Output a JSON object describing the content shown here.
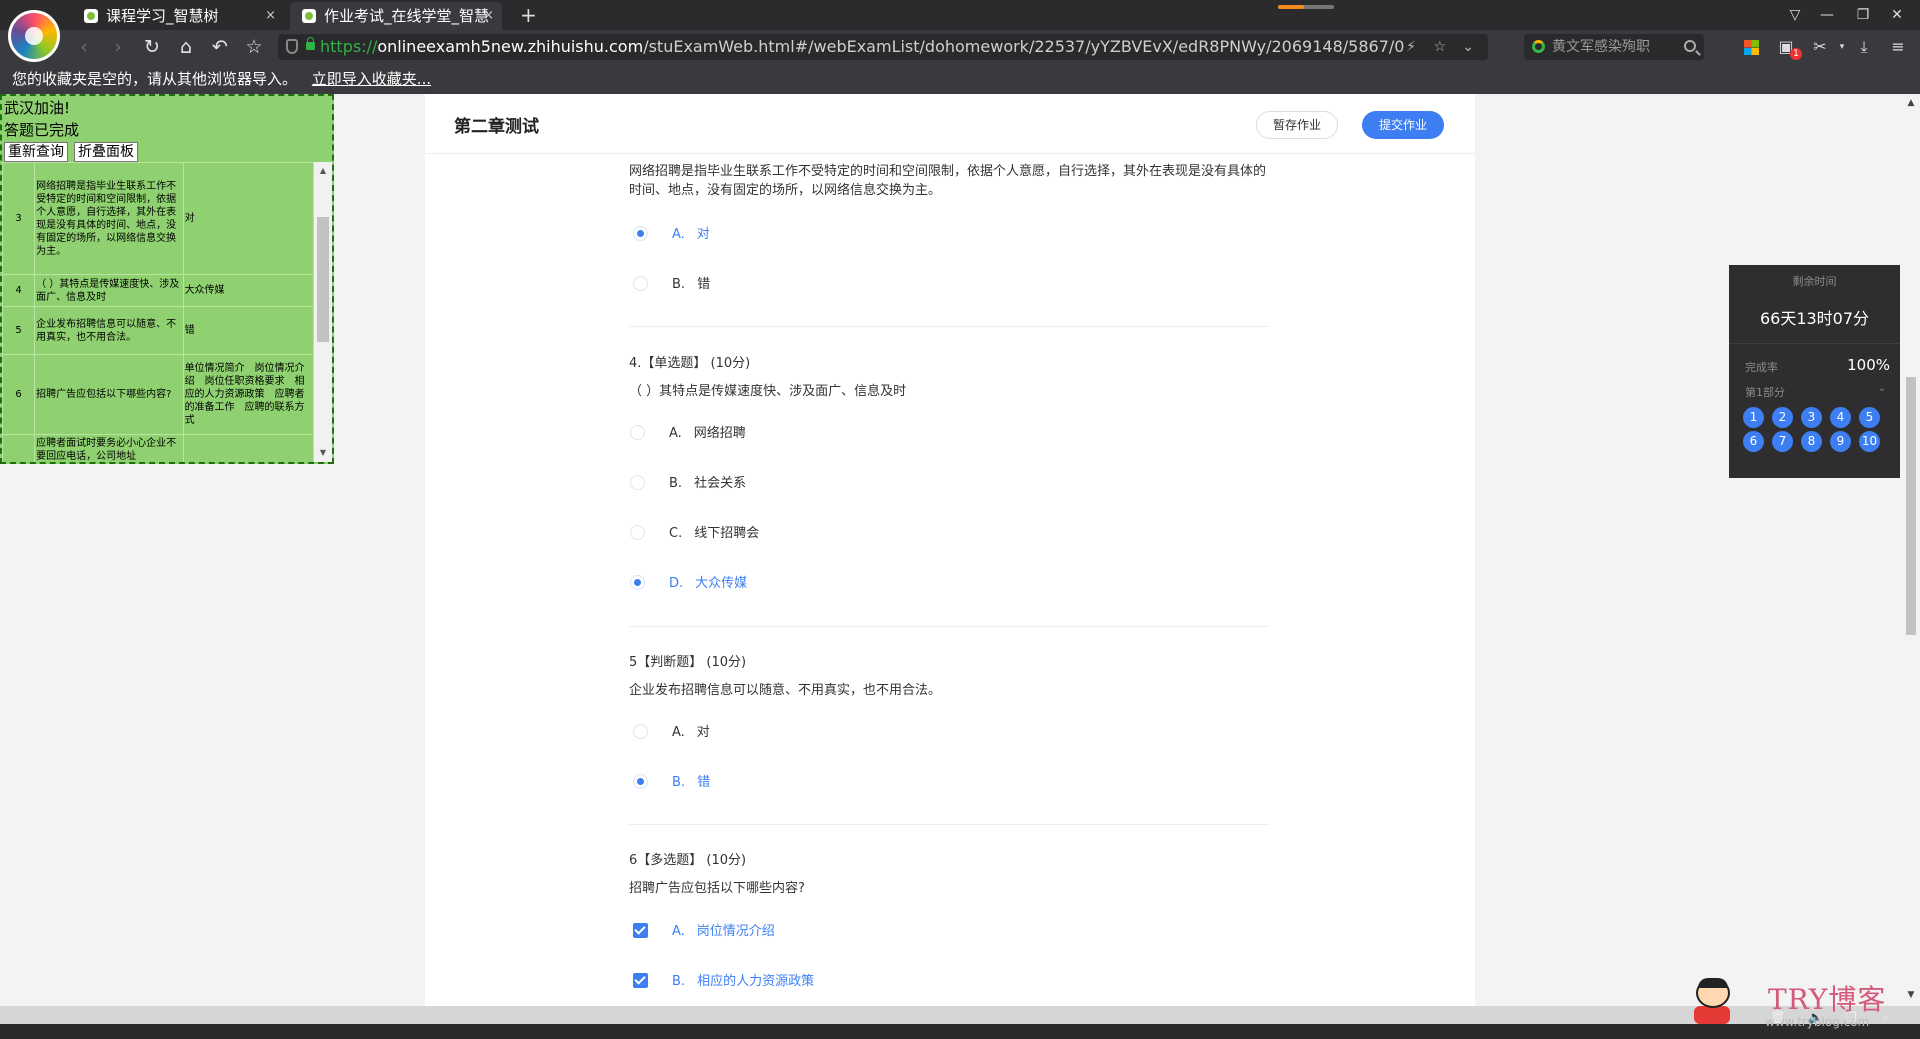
{
  "browser": {
    "tabs": [
      {
        "title": "课程学习_智慧树",
        "close": "×"
      },
      {
        "title": "作业考试_在线学堂_智慧",
        "close": "×"
      }
    ],
    "new_tab": "+",
    "url": {
      "protocol": "https://",
      "host": "onlineexamh5new.zhihuishu.com",
      "path": "/stuExamWeb.html#/webExamList/dohomework/22537/yYZBVEvX/edR8PNWy/2069148/5867/0"
    },
    "search_placeholder": "黄文军感染殉职",
    "bookmark_bar": {
      "message": "您的收藏夹是空的，请从其他浏览器导入。",
      "import_link": "立即导入收藏夹..."
    },
    "notification_count": "1"
  },
  "helper": {
    "line1": "武汉加油!",
    "line2": "答题已完成",
    "requery_label": "重新查询",
    "collapse_label": "折叠面板",
    "rows": [
      {
        "num": "3",
        "question": "网络招聘是指毕业生联系工作不受特定的时间和空间限制，依据个人意愿，自行选择，其外在表现是没有具体的时间、地点，没有固定的场所，以网络信息交换为主。",
        "answer": "对"
      },
      {
        "num": "4",
        "question": "（ ）其特点是传媒速度快、涉及面广、信息及时",
        "answer": "大众传媒"
      },
      {
        "num": "5",
        "question": "企业发布招聘信息可以随意、不用真实，也不用合法。",
        "answer": "错"
      },
      {
        "num": "6",
        "question": "招聘广告应包括以下哪些内容?",
        "answer": "单位情况简介　岗位情况介绍　岗位任职资格要求　相应的人力资源政策　应聘者的准备工作　应聘的联系方式"
      },
      {
        "num": "",
        "question": "应聘者面试时要务必小心企业不要回应电话，公司地址",
        "answer": ""
      }
    ]
  },
  "exam": {
    "title": "第二章测试",
    "save_label": "暂存作业",
    "submit_label": "提交作业",
    "q3": {
      "text": "网络招聘是指毕业生联系工作不受特定的时间和空间限制，依据个人意愿，自行选择，其外在表现是没有具体的时间、地点，没有固定的场所，以网络信息交换为主。",
      "options": [
        {
          "letter": "A.",
          "text": "对",
          "selected": true
        },
        {
          "letter": "B.",
          "text": "错",
          "selected": false
        }
      ]
    },
    "q4": {
      "header": "4.【单选题】 (10分)",
      "text": "（ ）其特点是传媒速度快、涉及面广、信息及时",
      "options": [
        {
          "letter": "A.",
          "text": "网络招聘",
          "selected": false
        },
        {
          "letter": "B.",
          "text": "社会关系",
          "selected": false
        },
        {
          "letter": "C.",
          "text": "线下招聘会",
          "selected": false
        },
        {
          "letter": "D.",
          "text": "大众传媒",
          "selected": true
        }
      ]
    },
    "q5": {
      "header": "5【判断题】 (10分)",
      "text": "企业发布招聘信息可以随意、不用真实，也不用合法。",
      "options": [
        {
          "letter": "A.",
          "text": "对",
          "selected": false
        },
        {
          "letter": "B.",
          "text": "错",
          "selected": true
        }
      ]
    },
    "q6": {
      "header": "6【多选题】 (10分)",
      "text": "招聘广告应包括以下哪些内容?",
      "options": [
        {
          "letter": "A.",
          "text": "岗位情况介绍",
          "selected": true
        },
        {
          "letter": "B.",
          "text": "相应的人力资源政策",
          "selected": true
        }
      ]
    }
  },
  "timer": {
    "label": "剩余时间",
    "value": "66天13时07分",
    "rate_label": "完成率",
    "rate_value": "100%",
    "part_label": "第1部分",
    "numbers": [
      "1",
      "2",
      "3",
      "4",
      "5",
      "6",
      "7",
      "8",
      "9",
      "10"
    ]
  },
  "watermark": {
    "main": "TRY博客",
    "sub": "www.tryblog.com"
  },
  "colors": {
    "accent": "#3d7ff2",
    "helper_bg": "#8fd171",
    "chrome_dark": "#2b2b2e"
  }
}
